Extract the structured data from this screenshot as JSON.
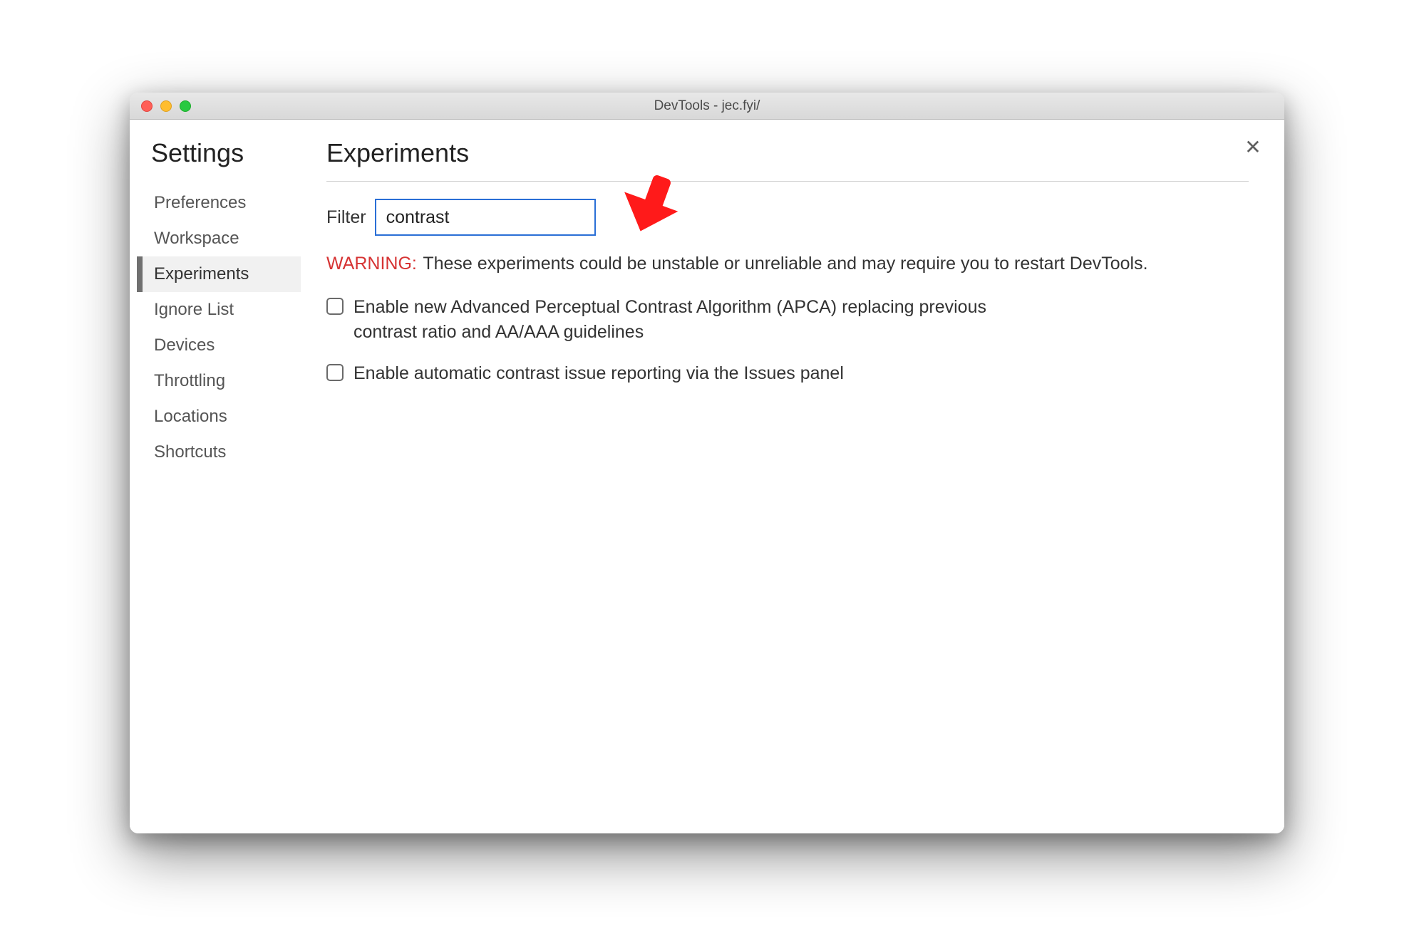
{
  "window": {
    "title": "DevTools - jec.fyi/"
  },
  "sidebar": {
    "title": "Settings",
    "items": [
      {
        "label": "Preferences",
        "active": false
      },
      {
        "label": "Workspace",
        "active": false
      },
      {
        "label": "Experiments",
        "active": true
      },
      {
        "label": "Ignore List",
        "active": false
      },
      {
        "label": "Devices",
        "active": false
      },
      {
        "label": "Throttling",
        "active": false
      },
      {
        "label": "Locations",
        "active": false
      },
      {
        "label": "Shortcuts",
        "active": false
      }
    ]
  },
  "main": {
    "title": "Experiments",
    "filter_label": "Filter",
    "filter_value": "contrast",
    "warning_prefix": "WARNING:",
    "warning_text": "These experiments could be unstable or unreliable and may require you to restart DevTools.",
    "experiments": [
      {
        "label": "Enable new Advanced Perceptual Contrast Algorithm (APCA) replacing previous contrast ratio and AA/AAA guidelines",
        "checked": false
      },
      {
        "label": "Enable automatic contrast issue reporting via the Issues panel",
        "checked": false
      }
    ]
  },
  "annotation": {
    "arrow_color": "#ff1a1a"
  }
}
